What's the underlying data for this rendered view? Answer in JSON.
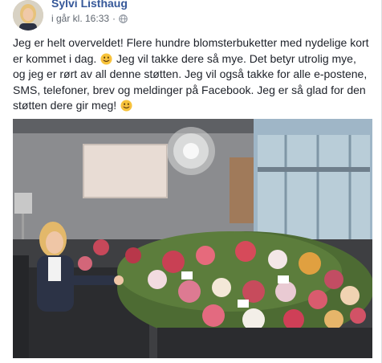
{
  "post": {
    "author": "Sylvi Listhaug",
    "timestamp": "i går kl. 16:33",
    "separator": "·",
    "privacy_icon": "globe-icon",
    "text_line1": "Jeg er helt overveldet! Flere hundre blomsterbuketter med nydelige kort er kommet i dag.",
    "text_line1b": "Jeg vil takke dere så mye. Det betyr utrolig mye, og jeg er rørt av all denne støtten. Jeg vil også takke for alle e-postene, SMS, telefoner, brev og meldinger på Facebook. Jeg er så glad for den støtten dere gir meg!",
    "emoji_icon": "smiling-face-emoji",
    "photo_alt": "woman-sitting-among-flower-bouquets"
  },
  "colors": {
    "author": "#365899",
    "meta": "#606770",
    "text": "#1d2129"
  }
}
